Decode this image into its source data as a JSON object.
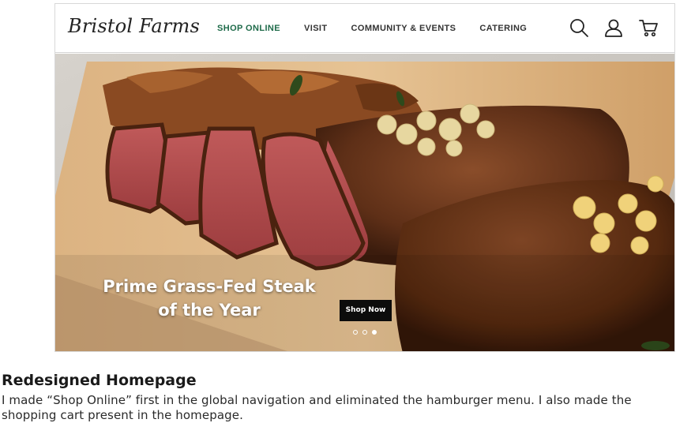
{
  "header": {
    "logo_text": "Bristol Farms",
    "nav": [
      {
        "label": "SHOP ONLINE",
        "active": true
      },
      {
        "label": "VISIT",
        "active": false
      },
      {
        "label": "COMMUNITY & EVENTS",
        "active": false
      },
      {
        "label": "CATERING",
        "active": false
      }
    ],
    "icons": [
      "search-icon",
      "user-icon",
      "cart-icon"
    ],
    "active_color": "#1f6b4a"
  },
  "hero": {
    "headline_line1": "Prime Grass-Fed Steak",
    "headline_line2": "of the Year",
    "cta_label": "Shop Now",
    "slides_count": 3,
    "active_slide": 3
  },
  "caption": {
    "title": "Redesigned Homepage",
    "body": "I made “Shop Online” first in the global navigation and eliminated the hamburger menu. I also made the shopping cart present in the homepage."
  }
}
